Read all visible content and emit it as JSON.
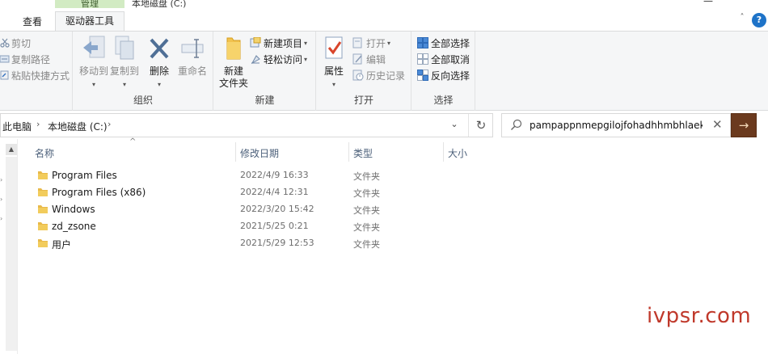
{
  "title_bar": {
    "manage_tab": "管理",
    "window_title": "本地磁盘 (C:)",
    "window_button": "—",
    "tabs": [
      {
        "label": "查看"
      },
      {
        "label": "驱动器工具"
      }
    ],
    "collapse_glyph": "˄",
    "help_glyph": "?"
  },
  "ribbon": {
    "clipboard": {
      "cut": "剪切",
      "copy_path": "复制路径",
      "paste_shortcut": "粘贴快捷方式"
    },
    "organize": {
      "label": "组织",
      "move_to": "移动到",
      "copy_to": "复制到",
      "delete": "删除",
      "rename": "重命名"
    },
    "new": {
      "label": "新建",
      "new_folder_line1": "新建",
      "new_folder_line2": "文件夹",
      "new_item": "新建项目",
      "easy_access": "轻松访问"
    },
    "open": {
      "label": "打开",
      "properties": "属性",
      "open": "打开",
      "edit": "编辑",
      "history": "历史记录"
    },
    "select": {
      "label": "选择",
      "select_all": "全部选择",
      "select_none": "全部取消",
      "invert": "反向选择"
    }
  },
  "address": {
    "crumbs": [
      "此电脑",
      "本地磁盘 (C:)"
    ],
    "separator": "›",
    "dropdown_glyph": "⌄",
    "refresh_glyph": "↻"
  },
  "search": {
    "value": "pampappnmepgilojfohadhhmbhlaek",
    "clear_glyph": "✕",
    "go_glyph": "→"
  },
  "columns": {
    "name": "名称",
    "modified": "修改日期",
    "type": "类型",
    "size": "大小",
    "sort_glyph": "^"
  },
  "files": [
    {
      "name": "Program Files",
      "modified": "2022/4/9 16:33",
      "type": "文件夹"
    },
    {
      "name": "Program Files (x86)",
      "modified": "2022/4/4 12:31",
      "type": "文件夹"
    },
    {
      "name": "Windows",
      "modified": "2022/3/20 15:42",
      "type": "文件夹"
    },
    {
      "name": "zd_zsone",
      "modified": "2021/5/25 0:21",
      "type": "文件夹"
    },
    {
      "name": "用户",
      "modified": "2021/5/29 12:53",
      "type": "文件夹"
    }
  ],
  "watermark": "ivpsr.com",
  "colors": {
    "manage_tab": "#d2ebc3",
    "search_go": "#6b3a1e",
    "folder": "#e8b94a",
    "watermark": "#c0392b",
    "accent_blue": "#1e73c8"
  }
}
